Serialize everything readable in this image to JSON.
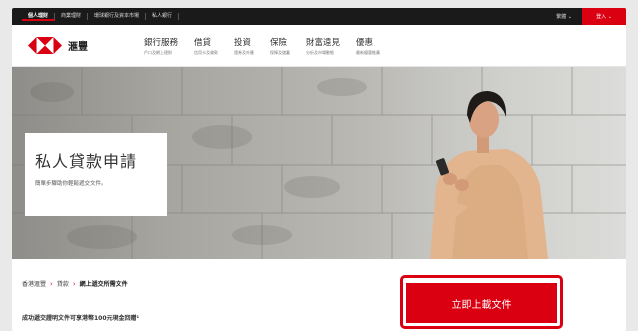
{
  "topbar": {
    "segments": [
      "個人理財",
      "商業理財",
      "環球銀行及資本市場",
      "私人銀行"
    ],
    "language": "繁體 ⌄",
    "login": "登入 ⌄"
  },
  "brand": {
    "name": "滙豐",
    "accent": "#db0011"
  },
  "nav": {
    "items": [
      {
        "title": "銀行服務",
        "subtitle": "戶口及網上理財"
      },
      {
        "title": "借貸",
        "subtitle": "信用卡及貸款"
      },
      {
        "title": "投資",
        "subtitle": "證券及外匯"
      },
      {
        "title": "保險",
        "subtitle": "保障及儲蓄"
      },
      {
        "title": "財富遠見",
        "subtitle": "分析及市場動態"
      },
      {
        "title": "優惠",
        "subtitle": "最新優惠推廣"
      }
    ]
  },
  "hero": {
    "title": "私人貸款申請",
    "subtitle": "簡單步驟助你輕鬆遞交文件。"
  },
  "breadcrumb": {
    "items": [
      "香港滙豐",
      "貸款",
      "網上遞交所需文件"
    ],
    "separator": "›"
  },
  "promo": "成功遞交證明文件可享港幣100元現金回贈¹",
  "cta": {
    "label": "立即上載文件"
  }
}
